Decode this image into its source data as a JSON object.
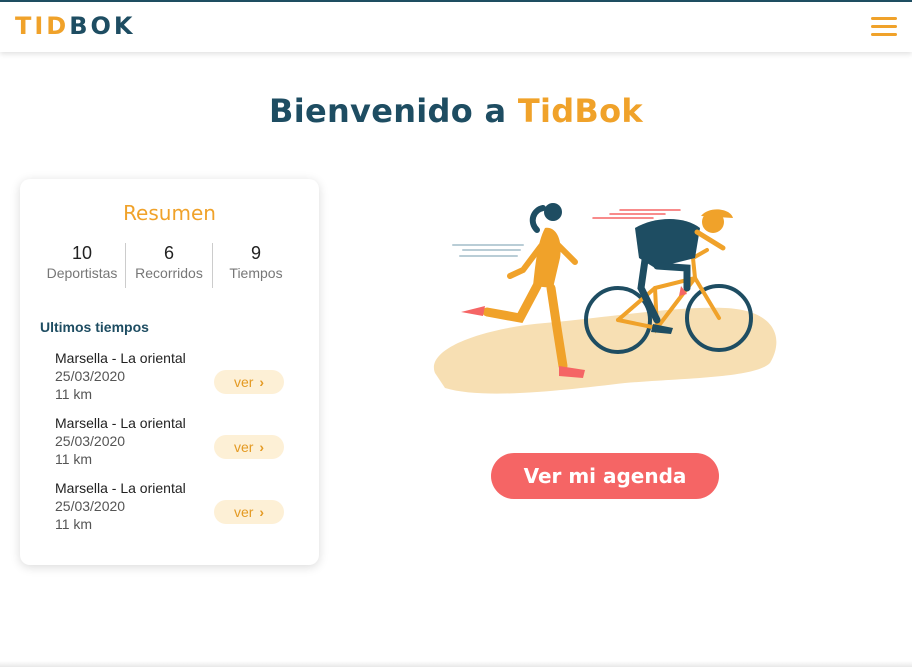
{
  "header": {
    "logo_part1": "TID",
    "logo_part2": "BOK",
    "menu_icon": "hamburger-icon",
    "accent_color": "#f0a22a",
    "brand_dark_color": "#1e4d62"
  },
  "hero": {
    "welcome": "Bienvenido a ",
    "brand": "TidBok"
  },
  "summary": {
    "title": "Resumen",
    "stats": [
      {
        "value": "10",
        "label": "Deportistas"
      },
      {
        "value": "6",
        "label": "Recorridos"
      },
      {
        "value": "9",
        "label": "Tiempos"
      }
    ],
    "recent_title": "Ultimos tiempos",
    "recent": [
      {
        "name": "Marsella - La oriental",
        "date": "25/03/2020",
        "distance": "11 km",
        "action": "ver"
      },
      {
        "name": "Marsella - La oriental",
        "date": "25/03/2020",
        "distance": "11 km",
        "action": "ver"
      },
      {
        "name": "Marsella - La oriental",
        "date": "25/03/2020",
        "distance": "11 km",
        "action": "ver"
      }
    ]
  },
  "illustration": {
    "icon": "runner-and-cyclist-illustration"
  },
  "cta": {
    "label": "Ver mi agenda",
    "color": "#f56565"
  }
}
